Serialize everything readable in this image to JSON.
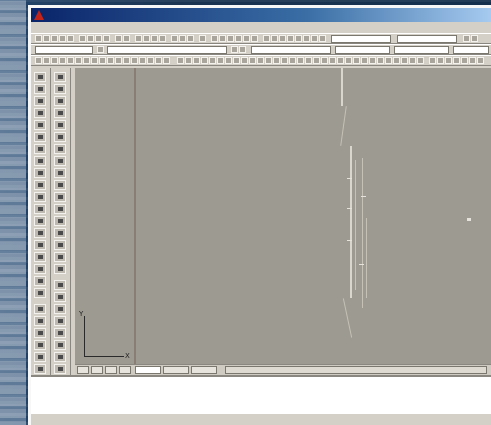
{
  "window": {
    "title": "",
    "accent_color": "#c0241a"
  },
  "menubar": {
    "items": []
  },
  "toolbars": [
    {
      "name": "standard"
    },
    {
      "name": "properties"
    },
    {
      "name": "layers"
    }
  ],
  "side_toolbars": [
    "draw",
    "modify"
  ],
  "drawing": {
    "background_color": "#9d9a91",
    "ucs_icon": {
      "x_label": "X",
      "y_label": "Y"
    }
  },
  "layout_tabs": [],
  "command_window": {
    "lines": []
  },
  "status_bar": {
    "text": ""
  }
}
